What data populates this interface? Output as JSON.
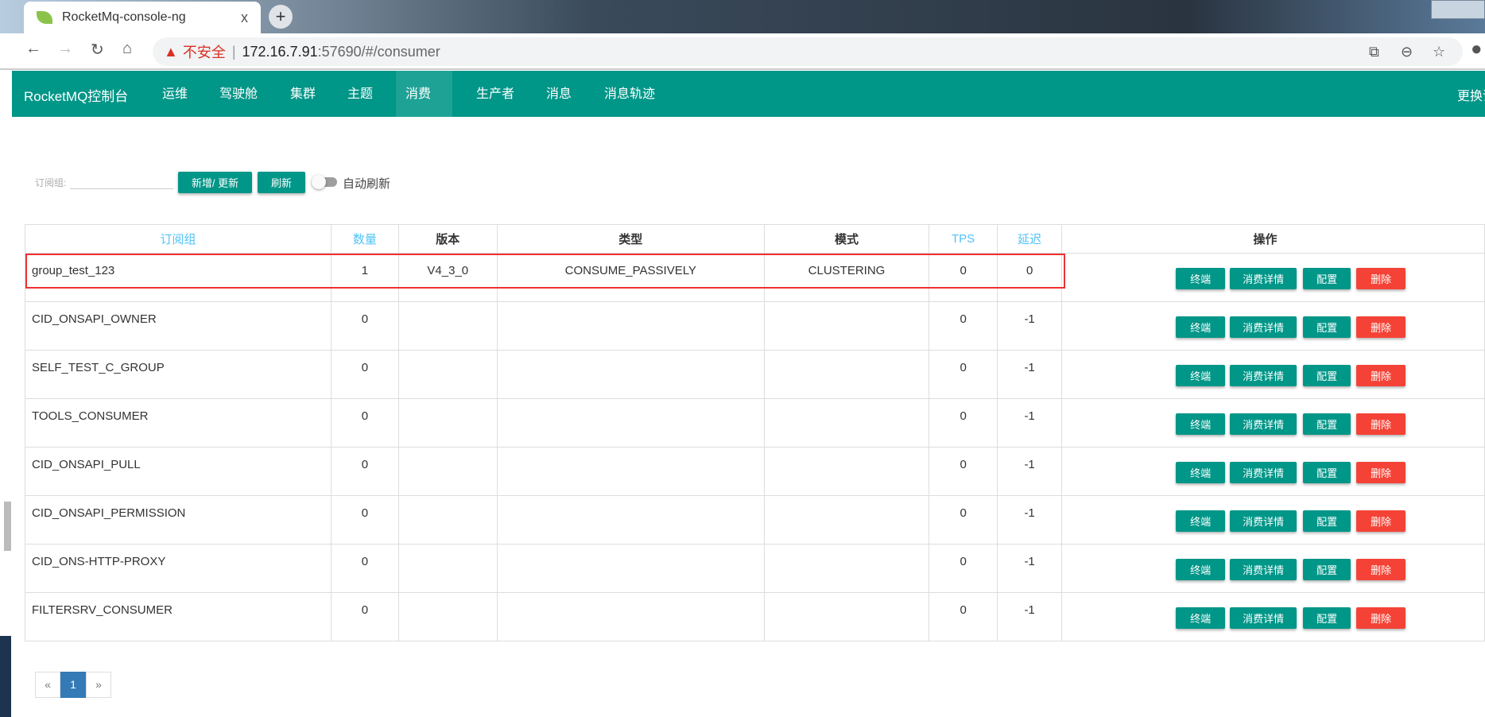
{
  "browser": {
    "tab_title": "RocketMq-console-ng",
    "close": "x",
    "new_tab": "+",
    "insecure": "不安全",
    "url_host": "172.16.7.91",
    "url_rest": ":57690/#/consumer"
  },
  "nav": {
    "brand": "RocketMQ控制台",
    "items": [
      "运维",
      "驾驶舱",
      "集群",
      "主题",
      "消费者",
      "生产者",
      "消息",
      "消息轨迹"
    ],
    "active": "消费者",
    "right": "更换语言"
  },
  "toolbar": {
    "group_label": "订阅组:",
    "group_value": "",
    "add_update": "新增/ 更新",
    "refresh": "刷新",
    "auto_refresh": "自动刷新",
    "auto_refresh_on": false
  },
  "table": {
    "headers": [
      "订阅组",
      "数量",
      "版本",
      "类型",
      "模式",
      "TPS",
      "延迟",
      "操作"
    ],
    "rows": [
      {
        "group": "group_test_123",
        "count": "1",
        "version": "V4_3_0",
        "type": "CONSUME_PASSIVELY",
        "mode": "CLUSTERING",
        "tps": "0",
        "delay": "0"
      },
      {
        "group": "CID_ONSAPI_OWNER",
        "count": "0",
        "version": "",
        "type": "",
        "mode": "",
        "tps": "0",
        "delay": "-1"
      },
      {
        "group": "SELF_TEST_C_GROUP",
        "count": "0",
        "version": "",
        "type": "",
        "mode": "",
        "tps": "0",
        "delay": "-1"
      },
      {
        "group": "TOOLS_CONSUMER",
        "count": "0",
        "version": "",
        "type": "",
        "mode": "",
        "tps": "0",
        "delay": "-1"
      },
      {
        "group": "CID_ONSAPI_PULL",
        "count": "0",
        "version": "",
        "type": "",
        "mode": "",
        "tps": "0",
        "delay": "-1"
      },
      {
        "group": "CID_ONSAPI_PERMISSION",
        "count": "0",
        "version": "",
        "type": "",
        "mode": "",
        "tps": "0",
        "delay": "-1"
      },
      {
        "group": "CID_ONS-HTTP-PROXY",
        "count": "0",
        "version": "",
        "type": "",
        "mode": "",
        "tps": "0",
        "delay": "-1"
      },
      {
        "group": "FILTERSRV_CONSUMER",
        "count": "0",
        "version": "",
        "type": "",
        "mode": "",
        "tps": "0",
        "delay": "-1"
      }
    ],
    "actions": [
      "终端",
      "消费详情",
      "配置",
      "删除"
    ]
  },
  "pagination": {
    "prev": "«",
    "current": "1",
    "next": "»"
  },
  "colors": {
    "primary": "#009688",
    "danger": "#f44336",
    "highlight": "#f03030",
    "sort_header": "#4fc3f7"
  }
}
